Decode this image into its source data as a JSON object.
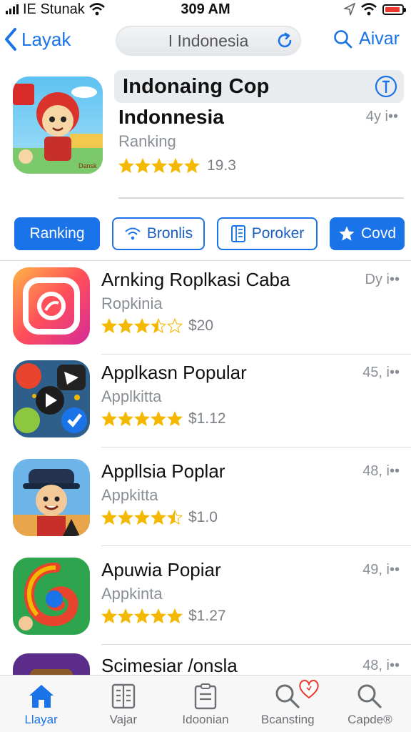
{
  "status_bar": {
    "carrier": "IE Stunak",
    "time": "309 AM"
  },
  "nav": {
    "back_label": "Layak",
    "search_text": "I Indonesia",
    "right_label": "Aivar"
  },
  "header": {
    "banner_title": "Indonaing Cop",
    "app_name": "Indonnesia",
    "meta": "4y i••",
    "subtitle": "Ranking",
    "rating_value": "19.3",
    "stars": 5,
    "icon_label": "Dansk"
  },
  "chips": [
    {
      "label": "Ranking",
      "icon": "none",
      "style": "filled"
    },
    {
      "label": "Bronlis",
      "icon": "wifi-icon",
      "style": "outline"
    },
    {
      "label": "Poroker",
      "icon": "book-icon",
      "style": "outline"
    },
    {
      "label": "Covd",
      "icon": "star-icon",
      "style": "filled"
    }
  ],
  "list": [
    {
      "name": "Arnking Roplkasi Caba",
      "sub": "Ropkinia",
      "price": "$20",
      "meta": "Dy i••",
      "stars": 3.5,
      "icon": "camera-icon"
    },
    {
      "name": "Applkasn Popular",
      "sub": "Applkitta",
      "price": "$1.12",
      "meta": "45, i••",
      "stars": 5,
      "icon": "media-apps-icon"
    },
    {
      "name": "Appllsia Poplar",
      "sub": "Appkitta",
      "price": "$1.0",
      "meta": "48, i••",
      "stars": 4.5,
      "icon": "character-icon"
    },
    {
      "name": "Apuwia Popiar",
      "sub": "Appkinta",
      "price": "$1.27",
      "meta": "49, i••",
      "stars": 5,
      "icon": "swirl-icon"
    },
    {
      "name": "Scimesiar /onsla",
      "sub": "",
      "price": "",
      "meta": "48, i••",
      "stars": 0,
      "icon": "purple-app-icon"
    }
  ],
  "tabs": [
    {
      "label": "Llayar",
      "icon": "home-icon",
      "active": true
    },
    {
      "label": "Vajar",
      "icon": "grid-list-icon",
      "active": false
    },
    {
      "label": "Idoonian",
      "icon": "clipboard-icon",
      "active": false
    },
    {
      "label": "Bcansting",
      "icon": "search-icon",
      "active": false
    },
    {
      "label": "Capde®",
      "icon": "search-icon",
      "active": false
    }
  ],
  "colors": {
    "accent": "#1a73e8",
    "star": "#f5b800",
    "battery": "#e8392c"
  }
}
